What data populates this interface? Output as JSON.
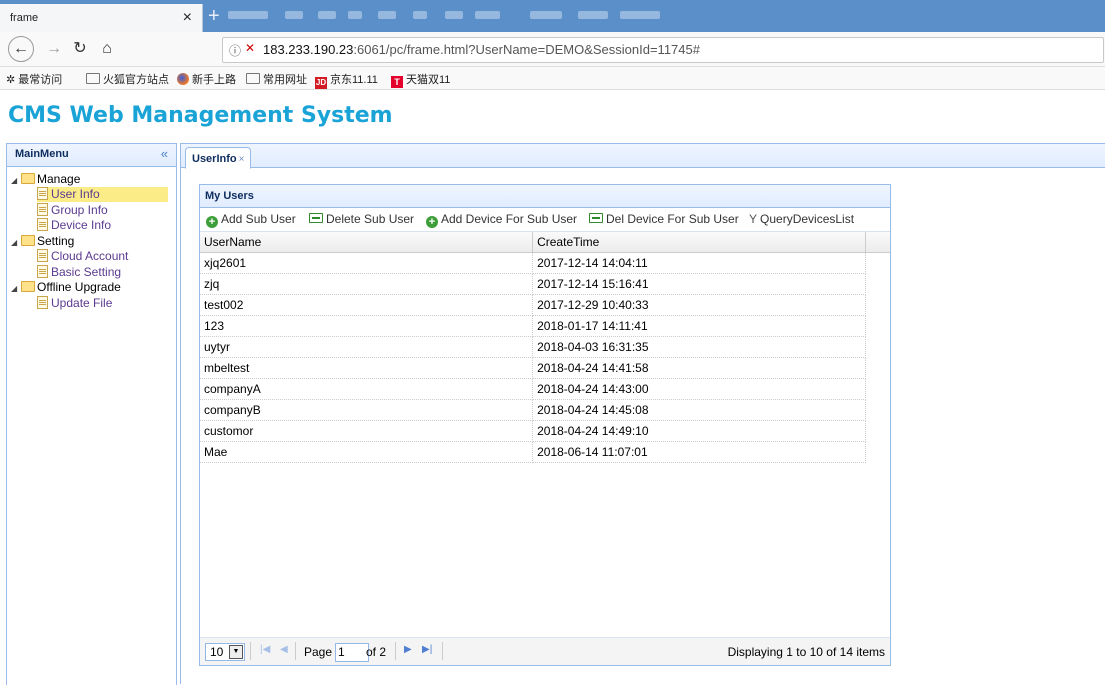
{
  "browser": {
    "tab_title": "frame",
    "tab_close": "×",
    "new_tab": "+",
    "url_host": "183.233.190.23",
    "url_rest": ":6061/pc/frame.html?UserName=DEMO&SessionId=11745#",
    "bookmarks": [
      {
        "label": "最常访问"
      },
      {
        "label": "火狐官方站点"
      },
      {
        "label": "新手上路"
      },
      {
        "label": "常用网址"
      },
      {
        "label": "京东11.11",
        "badge": "JD"
      },
      {
        "label": "天猫双11",
        "badge": "T"
      }
    ]
  },
  "app": {
    "title": "CMS Web Management System",
    "colors": {
      "title": "#1aa3d6",
      "border": "#99bbe8",
      "selected": "#fbec88"
    }
  },
  "menu": {
    "title": "MainMenu",
    "collapse_icon": "«",
    "groups": [
      {
        "label": "Manage",
        "items": [
          "User Info",
          "Group Info",
          "Device Info"
        ]
      },
      {
        "label": "Setting",
        "items": [
          "Cloud Account",
          "Basic Setting"
        ]
      },
      {
        "label": "Offline Upgrade",
        "items": [
          "Update File"
        ]
      }
    ],
    "selected": "User Info"
  },
  "tabs": [
    {
      "label": "UserInfo",
      "close": "×"
    }
  ],
  "grid": {
    "title": "My Users",
    "toolbar": [
      {
        "label": "Add Sub User",
        "icon": "add-icon"
      },
      {
        "label": "Delete Sub User",
        "icon": "remove-icon"
      },
      {
        "label": "Add Device For Sub User",
        "icon": "add-icon"
      },
      {
        "label": "Del Device For Sub User",
        "icon": "remove-icon"
      },
      {
        "label": "QueryDevicesList",
        "icon": "filter-icon"
      }
    ],
    "columns": [
      "UserName",
      "CreateTime"
    ],
    "rows": [
      [
        "xjq2601",
        "2017-12-14 14:04:11"
      ],
      [
        "zjq",
        "2017-12-14 15:16:41"
      ],
      [
        "test002",
        "2017-12-29 10:40:33"
      ],
      [
        "123",
        "2018-01-17 14:11:41"
      ],
      [
        "uytyr",
        "2018-04-03 16:31:35"
      ],
      [
        "mbeltest",
        "2018-04-24 14:41:58"
      ],
      [
        "companyA",
        "2018-04-24 14:43:00"
      ],
      [
        "companyB",
        "2018-04-24 14:45:08"
      ],
      [
        "customor",
        "2018-04-24 14:49:10"
      ],
      [
        "Mae",
        "2018-06-14 11:07:01"
      ]
    ],
    "pager": {
      "page_size": "10",
      "page_label": "Page",
      "page_value": "1",
      "of_label": "of 2",
      "info": "Displaying 1 to 10 of 14 items"
    }
  }
}
